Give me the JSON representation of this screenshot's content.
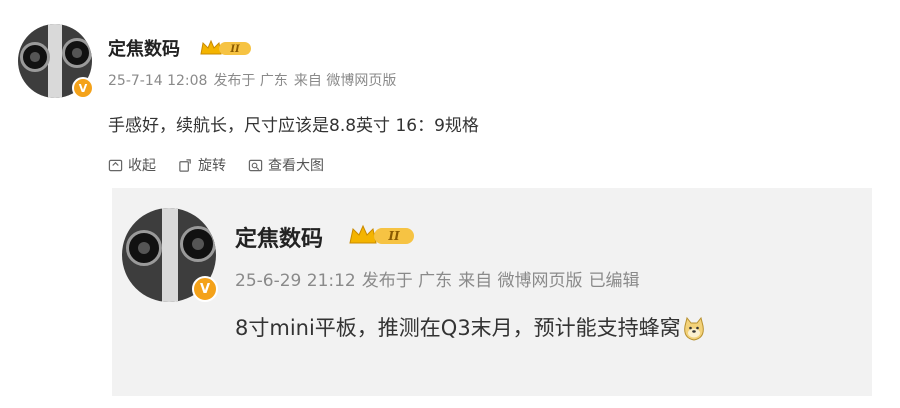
{
  "post": {
    "author": "定焦数码",
    "timestamp": "25-7-14 12:08",
    "location": "发布于 广东",
    "source": "来自 微博网页版",
    "content": "手感好，续航长，尺寸应该是8.8英寸 16：9规格",
    "actions": [
      {
        "label": "收起",
        "icon": "collapse-icon"
      },
      {
        "label": "旋转",
        "icon": "rotate-icon"
      },
      {
        "label": "查看大图",
        "icon": "view-image-icon"
      }
    ]
  },
  "repost": {
    "author": "定焦数码",
    "timestamp": "25-6-29 21:12",
    "location": "发布于 广东",
    "source": "来自 微博网页版",
    "edited": "已编辑",
    "content": "8寸mini平板，推测在Q3末月，预计能支持蜂窝"
  },
  "badges": {
    "verified": "V",
    "level": "II"
  },
  "colors": {
    "accent": "#f4a21a",
    "meta": "#8a8a8a",
    "repost_bg": "#f2f2f2"
  }
}
